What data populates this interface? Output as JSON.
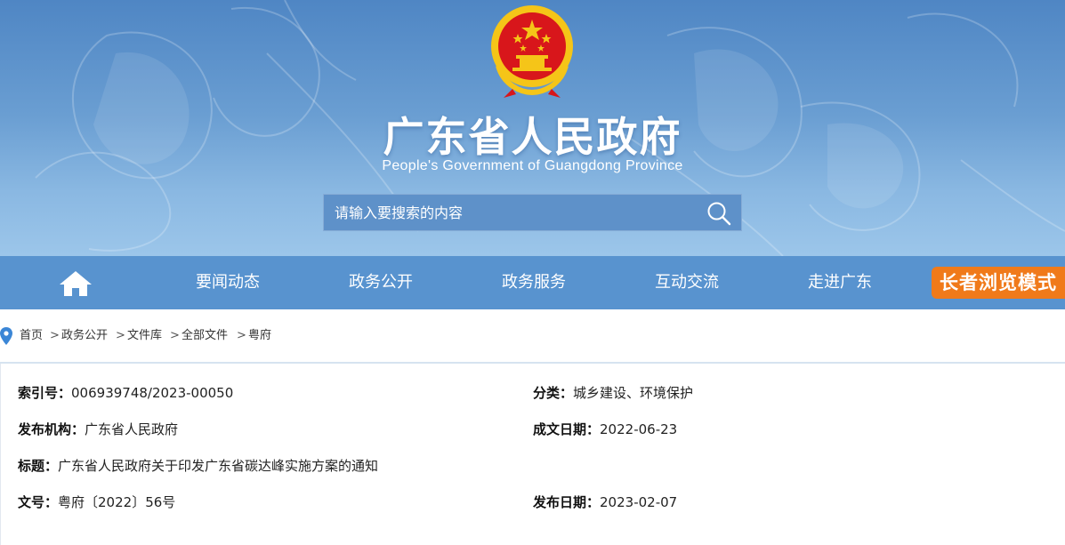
{
  "header": {
    "title": "广东省人民政府",
    "subtitle": "People's Government of Guangdong Province"
  },
  "search": {
    "placeholder": "请输入要搜索的内容"
  },
  "nav": {
    "items": [
      "要闻动态",
      "政务公开",
      "政务服务",
      "互动交流",
      "走进广东"
    ],
    "elder_mode": "长者浏览模式"
  },
  "breadcrumb": [
    "首页",
    "政务公开",
    "文件库",
    "全部文件",
    "粤府"
  ],
  "breadcrumb_sep": ">",
  "meta": {
    "index_no": {
      "label": "索引号：",
      "value": "006939748/2023-00050"
    },
    "category": {
      "label": "分类：",
      "value": "城乡建设、环境保护"
    },
    "issuer": {
      "label": "发布机构：",
      "value": "广东省人民政府"
    },
    "written_date": {
      "label": "成文日期：",
      "value": "2022-06-23"
    },
    "doc_title": {
      "label": "标题：",
      "value": "广东省人民政府关于印发广东省碳达峰实施方案的通知"
    },
    "doc_no": {
      "label": "文号：",
      "value": "粤府〔2022〕56号"
    },
    "publish_date": {
      "label": "发布日期：",
      "value": "2023-02-07"
    }
  },
  "colors": {
    "nav_bg": "#5893cf",
    "elder_button": "#f07a1a",
    "emblem_red": "#d8161b",
    "emblem_gold": "#f5c518",
    "pin_blue": "#3b86d6"
  }
}
